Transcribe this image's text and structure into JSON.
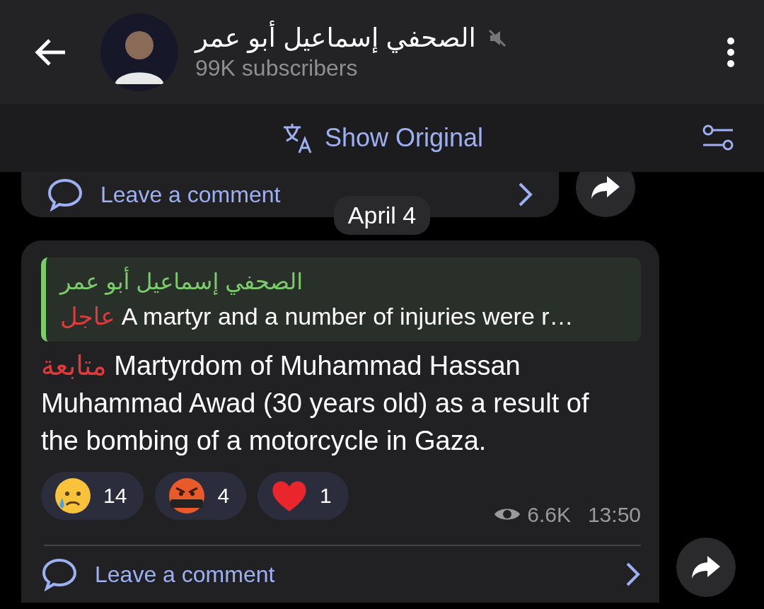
{
  "header": {
    "title": "الصحفي إسماعيل أبو عمر",
    "muted": true,
    "subtitle": "99K subscribers"
  },
  "translation_bar": {
    "label": "Show Original"
  },
  "previous_post": {
    "comment_label": "Leave a comment"
  },
  "date_separator": "April 4",
  "post": {
    "quote": {
      "author": "الصحفي إسماعيل أبو عمر",
      "tag": "عاجل",
      "text": "A martyr and a number of injuries were r…"
    },
    "tag": "متابعة",
    "text": "Martyrdom of Muhammad Hassan Muhammad Awad (30 years old) as a result of the bombing of a motorcycle in Gaza.",
    "reactions": [
      {
        "kind": "crying",
        "count": "14"
      },
      {
        "kind": "swearing",
        "count": "4"
      },
      {
        "kind": "heart",
        "count": "1"
      }
    ],
    "views": "6.6K",
    "time": "13:50",
    "comment_label": "Leave a comment"
  }
}
